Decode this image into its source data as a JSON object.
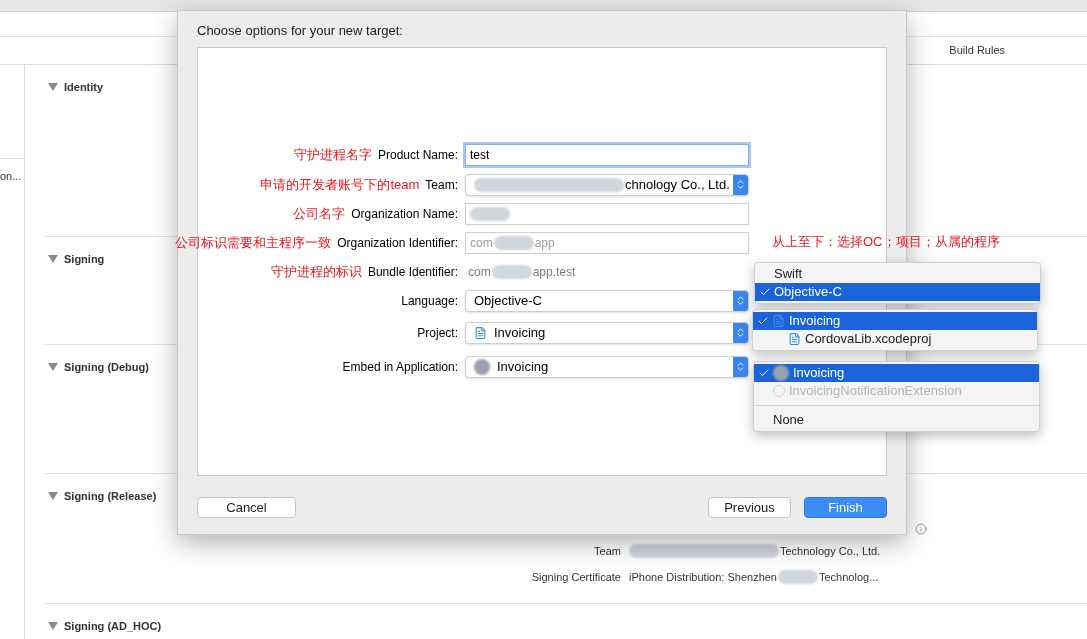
{
  "background": {
    "visible_tab": "Build Rules",
    "sidebar_item": "on...",
    "sections": [
      {
        "title": "Identity",
        "expanded": true
      },
      {
        "title": "Signing",
        "expanded": true
      },
      {
        "title": "Signing (Debug)",
        "expanded": true
      },
      {
        "title": "Signing (Release)",
        "expanded": true,
        "rows": [
          {
            "label": "Team",
            "redacted": true,
            "value_end": "Technology Co., Ltd."
          },
          {
            "label": "Signing Certificate",
            "value_start": "iPhone Distribution: Shenzhen",
            "redacted": true,
            "value_end": "Technolog..."
          }
        ]
      },
      {
        "title": "Signing (AD_HOC)",
        "expanded": true
      }
    ]
  },
  "dialog": {
    "title": "Choose options for your new target:",
    "fields": [
      {
        "kind": "text",
        "annotation": "守护进程名字",
        "label": "Product Name:",
        "value_start": "test",
        "focused": true,
        "disabled": false
      },
      {
        "kind": "popup",
        "annotation": "申请的开发者账号下的team",
        "label": "Team:",
        "redacted": true,
        "value_end": "chnology Co., Ltd."
      },
      {
        "kind": "text",
        "annotation": "公司名字",
        "label": "Organization Name:",
        "focused": false,
        "disabled": false,
        "redacted": true
      },
      {
        "kind": "text",
        "annotation": "公司标识需要和主程序一致",
        "label": "Organization Identifier:",
        "value_start": "com",
        "redacted": true,
        "value_end": "app",
        "focused": false,
        "disabled": true
      },
      {
        "kind": "static",
        "annotation": "守护进程的标识",
        "label": "Bundle Identifier:",
        "value_start": "com",
        "redacted": true,
        "value_end": "app.test"
      },
      {
        "kind": "popup",
        "label": "Language:",
        "value_start": "Objective-C"
      },
      {
        "kind": "project_popup",
        "label": "Project:",
        "value_start": "Invoicing"
      },
      {
        "kind": "app_popup",
        "label": "Embed in Application:",
        "value_start": "Invoicing"
      }
    ],
    "buttons": [
      {
        "label": "Cancel",
        "kind": "default"
      },
      {
        "label": "Previous",
        "kind": "default"
      },
      {
        "label": "Finish",
        "kind": "primary"
      }
    ]
  },
  "menus_note": "从上至下：选择OC；项目；从属的程序",
  "menus": [
    {
      "items": [
        {
          "kind": "item",
          "label": "Swift",
          "selected": false,
          "disabled": false
        },
        {
          "kind": "item",
          "label": "Objective-C",
          "selected": true,
          "disabled": false
        }
      ]
    },
    {
      "items": [
        {
          "kind": "project",
          "label": "Invoicing",
          "selected": true,
          "disabled": false,
          "children": [
            {
              "kind": "project",
              "label": "CordovaLib.xcodeproj",
              "selected": false,
              "disabled": false
            }
          ]
        }
      ]
    },
    {
      "items": [
        {
          "kind": "app",
          "label": "Invoicing",
          "selected": true,
          "disabled": false
        },
        {
          "kind": "extension",
          "label": "InvoicingNotificationExtension",
          "selected": false,
          "disabled": true
        },
        {
          "kind": "separator"
        },
        {
          "kind": "item",
          "label": "None",
          "selected": false,
          "disabled": false
        }
      ]
    }
  ]
}
